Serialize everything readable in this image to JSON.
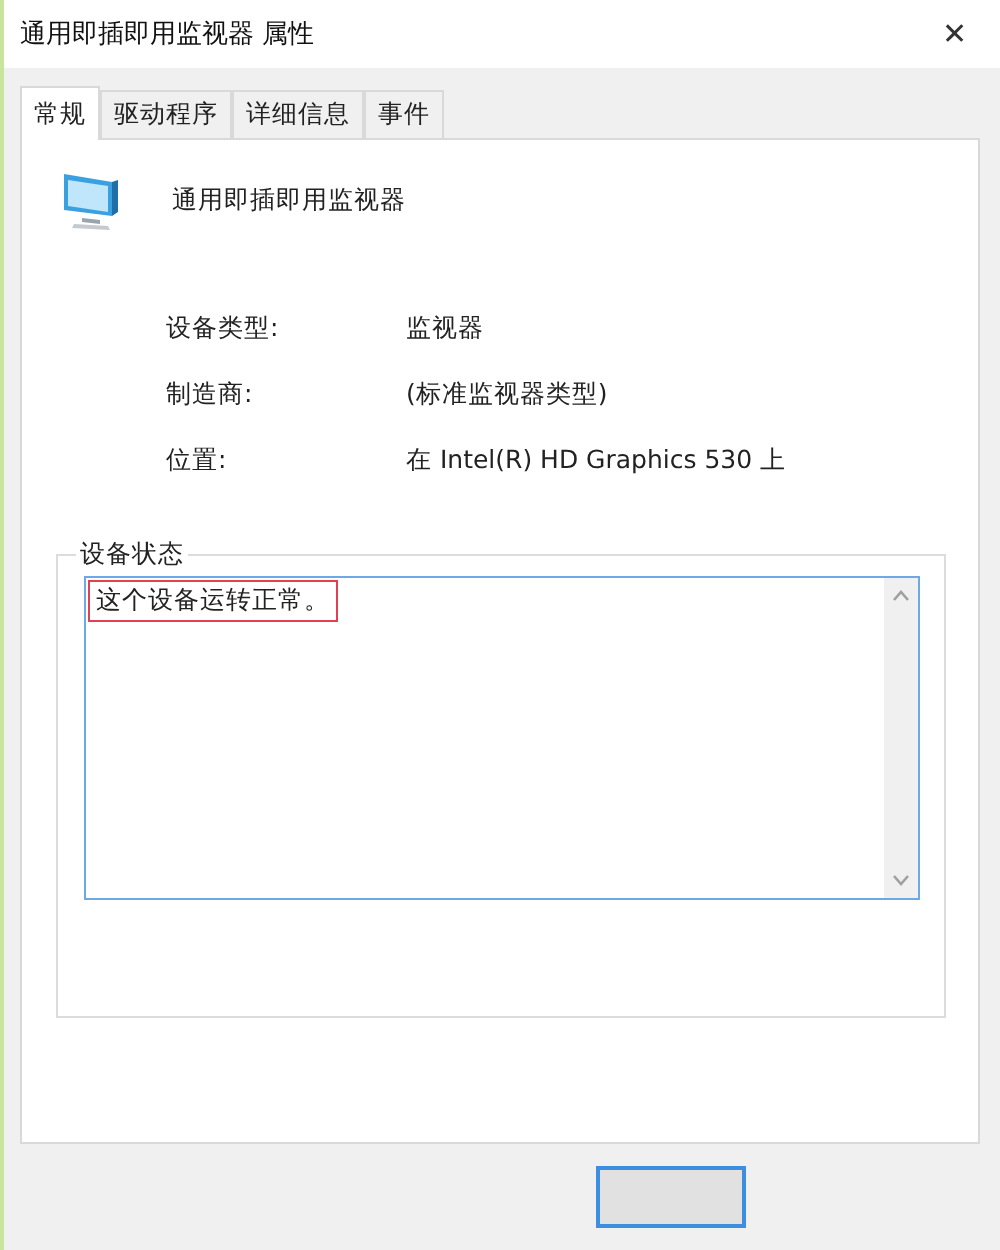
{
  "window": {
    "title": "通用即插即用监视器 属性",
    "close": "✕"
  },
  "tabs": [
    {
      "label": "常规",
      "selected": true
    },
    {
      "label": "驱动程序",
      "selected": false
    },
    {
      "label": "详细信息",
      "selected": false
    },
    {
      "label": "事件",
      "selected": false
    }
  ],
  "device": {
    "name": "通用即插即用监视器"
  },
  "properties": [
    {
      "label": "设备类型:",
      "value": "监视器"
    },
    {
      "label": "制造商:",
      "value": "(标准监视器类型)"
    },
    {
      "label": "位置:",
      "value": "在 Intel(R) HD Graphics 530 上"
    }
  ],
  "status": {
    "legend": "设备状态",
    "text": "这个设备运转正常。",
    "highlighted": true
  }
}
